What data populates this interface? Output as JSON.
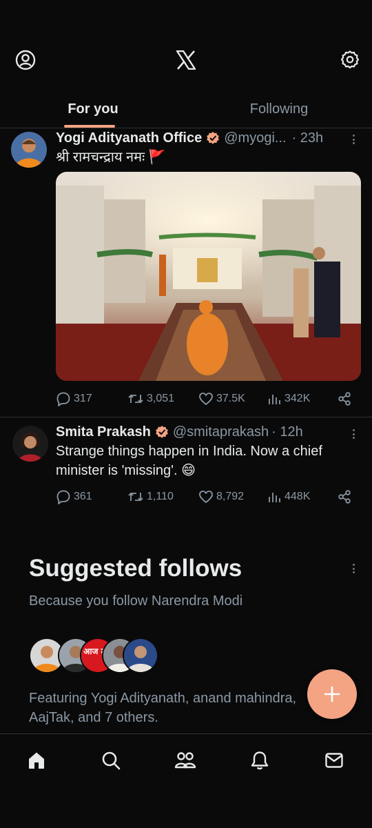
{
  "header": {
    "profile_icon": "profile-circle-icon",
    "logo_icon": "x-logo-icon",
    "settings_icon": "gear-icon"
  },
  "tabs": [
    {
      "label": "For you",
      "active": true
    },
    {
      "label": "Following",
      "active": false
    }
  ],
  "posts": [
    {
      "name": "Yogi Adityanath Office",
      "handle": "@myogi...",
      "time": "· 23h",
      "text": "श्री रामचन्द्राय नमः 🚩",
      "stats": {
        "replies": "317",
        "reposts": "3,051",
        "likes": "37.5K",
        "views": "342K"
      }
    },
    {
      "name": "Smita Prakash",
      "handle": "@smitaprakash",
      "time": "· 12h",
      "text": "Strange things happen in India. Now a chief minister is 'missing'. 😄",
      "stats": {
        "replies": "361",
        "reposts": "1,110",
        "likes": "8,792",
        "views": "448K"
      }
    }
  ],
  "suggested": {
    "title": "Suggested follows",
    "subtitle": "Because you follow Narendra Modi",
    "featuring": "Featuring Yogi Adityanath, anand mahindra, AajTak, and 7 others.",
    "aajtak_text": "आज तक"
  },
  "fab": {
    "icon": "plus-icon"
  },
  "bottom_nav": [
    "home-icon",
    "search-icon",
    "communities-icon",
    "notifications-icon",
    "messages-icon"
  ],
  "colors": {
    "accent": "#f4a383",
    "background": "#0a0a0a",
    "muted": "#8b98a5",
    "verified": "#f4a383"
  }
}
